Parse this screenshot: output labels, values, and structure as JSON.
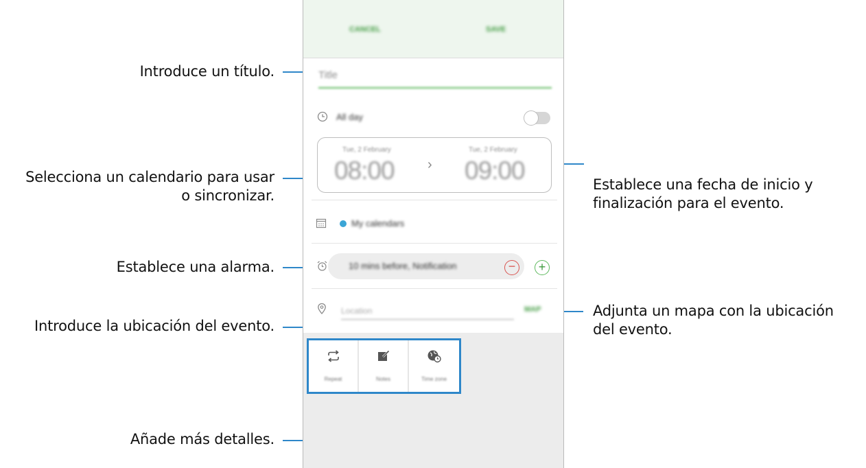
{
  "callouts": {
    "title": "Introduce un título.",
    "calendar_line1": "Selecciona un calendario para usar",
    "calendar_line2": "o sincronizar.",
    "alarm": "Establece una alarma.",
    "location": "Introduce la ubicación del evento.",
    "details": "Añade más detalles.",
    "date_line1": "Establece una fecha de inicio y",
    "date_line2": "finalización para el evento.",
    "map_line1": "Adjunta un mapa con la ubicación",
    "map_line2": "del evento."
  },
  "appbar": {
    "cancel_label": "CANCEL",
    "save_label": "SAVE"
  },
  "form": {
    "title_placeholder": "Title",
    "all_day_label": "All day",
    "start_caption": "Tue, 2 February",
    "start_time": "08:00",
    "end_caption": "Tue, 2 February",
    "end_time": "09:00",
    "calendar_name": "My calendars",
    "alarm_value": "10 mins before, Notification",
    "location_placeholder": "Location",
    "map_label": "MAP"
  },
  "details": [
    {
      "label": "Repeat",
      "icon": "repeat-icon"
    },
    {
      "label": "Notes",
      "icon": "notes-icon"
    },
    {
      "label": "Time zone",
      "icon": "time-zone-icon"
    }
  ],
  "colors": {
    "callout_line": "#2e87c9",
    "accent_green": "#5cb85c",
    "calendar_dot": "#3ba5d6",
    "remove_red": "#d9534f"
  }
}
